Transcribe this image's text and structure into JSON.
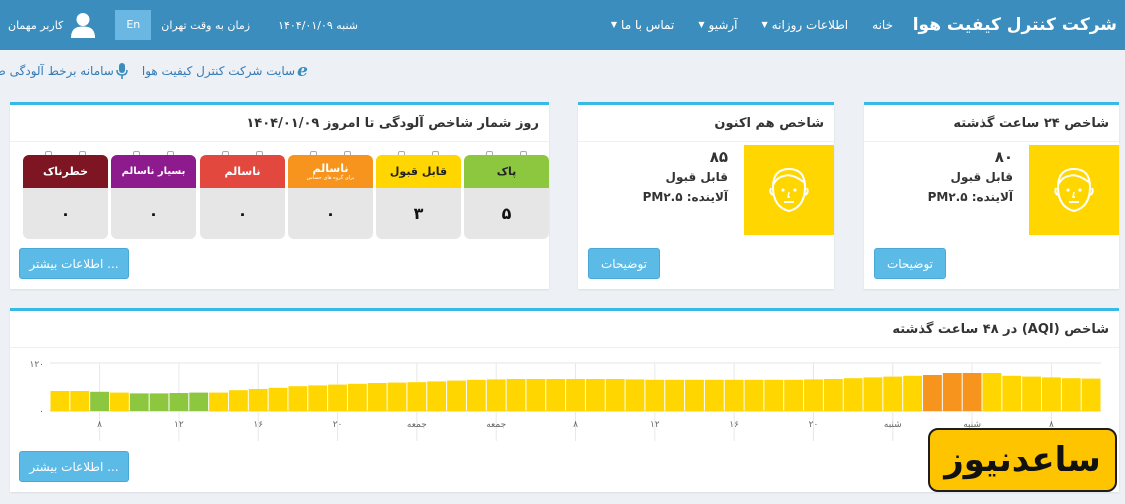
{
  "navbar": {
    "brand": "شرکت کنترل کیفیت هوا",
    "menu": [
      {
        "label": "خانه",
        "dropdown": false
      },
      {
        "label": "اطلاعات روزانه",
        "dropdown": true
      },
      {
        "label": "آرشیو",
        "dropdown": true
      },
      {
        "label": "تماس با ما",
        "dropdown": true
      }
    ],
    "date": "شنبه ۱۴۰۴/۰۱/۰۹",
    "time_label": "زمان به وقت تهران",
    "lang": "En",
    "user": "کاربر مهمان"
  },
  "links": {
    "site": "سایت شرکت کنترل کیفیت هوا",
    "noise": "سامانه برخط آلودگی صدا"
  },
  "aqi24": {
    "title": "شاخص ۲۴ ساعت گذشته",
    "value": "۸۰",
    "status": "قابل قبول",
    "pollutant": "آلاینده: PM۲.۵",
    "button": "توضیحات",
    "color": "#ffd600"
  },
  "aqinow": {
    "title": "شاخص هم اکنون",
    "value": "۸۵",
    "status": "قابل قبول",
    "pollutant": "آلاینده: PM۲.۵",
    "button": "توضیحات",
    "color": "#ffd600"
  },
  "calendar": {
    "title": "روز شمار شاخص آلودگی تا امروز ۱۴۰۴/۰۱/۰۹",
    "button": "اطلاعات بیشتر ...",
    "items": [
      {
        "label": "پاک",
        "sub": "",
        "value": "۵",
        "color": "#8dc63f",
        "dark": true
      },
      {
        "label": "قابل قبول",
        "sub": "",
        "value": "۳",
        "color": "#ffd600",
        "dark": true
      },
      {
        "label": "ناسالم",
        "sub": "برای گروه های حساس",
        "value": "۰",
        "color": "#f7941d",
        "dark": false
      },
      {
        "label": "ناسالم",
        "sub": "",
        "value": "۰",
        "color": "#e2483d",
        "dark": false
      },
      {
        "label": "بسیار ناسالم",
        "sub": "",
        "value": "۰",
        "color": "#8e1b8e",
        "dark": false
      },
      {
        "label": "خطرناک",
        "sub": "",
        "value": "۰",
        "color": "#7d1522",
        "dark": false
      }
    ]
  },
  "chart": {
    "title": "شاخص (AQI) در ۴۸ ساعت گذشته",
    "button": "اطلاعات بیشتر ...",
    "chart_data": {
      "type": "bar",
      "ylim": [
        0,
        120
      ],
      "yticks": [
        "۰",
        "۱۲۰"
      ],
      "xticks": [
        "۸",
        "۱۲",
        "۱۶",
        "۲۰",
        "جمعه",
        "جمعه",
        "۸",
        "۱۲",
        "۱۶",
        "۲۰",
        "شنبه",
        "شنبه",
        "۸"
      ],
      "xtick_positions": [
        2,
        6,
        10,
        14,
        18,
        22,
        26,
        30,
        34,
        38,
        42,
        46,
        50
      ],
      "values": [
        50,
        50,
        48,
        46,
        44,
        44,
        45,
        46,
        46,
        52,
        55,
        58,
        62,
        64,
        66,
        68,
        70,
        71,
        72,
        74,
        76,
        78,
        79,
        80,
        80,
        80,
        80,
        80,
        80,
        79,
        78,
        78,
        78,
        78,
        78,
        78,
        78,
        78,
        79,
        80,
        82,
        84,
        86,
        88,
        90,
        95,
        95,
        95,
        88,
        86,
        84,
        82,
        81
      ],
      "colors": {
        "good": "#8dc63f",
        "moderate": "#ffd600",
        "usg": "#f7941d"
      },
      "color_index": [
        "moderate",
        "moderate",
        "good",
        "moderate",
        "good",
        "good",
        "good",
        "good",
        "moderate",
        "moderate",
        "moderate",
        "moderate",
        "moderate",
        "moderate",
        "moderate",
        "moderate",
        "moderate",
        "moderate",
        "moderate",
        "moderate",
        "moderate",
        "moderate",
        "moderate",
        "moderate",
        "moderate",
        "moderate",
        "moderate",
        "moderate",
        "moderate",
        "moderate",
        "moderate",
        "moderate",
        "moderate",
        "moderate",
        "moderate",
        "moderate",
        "moderate",
        "moderate",
        "moderate",
        "moderate",
        "moderate",
        "moderate",
        "moderate",
        "moderate",
        "usg",
        "usg",
        "usg",
        "moderate",
        "moderate",
        "moderate",
        "moderate",
        "moderate",
        "moderate"
      ]
    }
  },
  "watermark": "ساعدنیوز"
}
